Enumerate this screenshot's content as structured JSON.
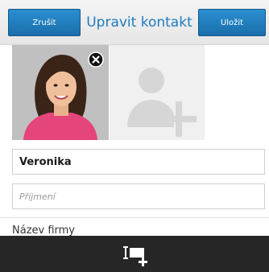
{
  "header": {
    "cancel_label": "Zrušit",
    "title": "Upravit kontakt",
    "save_label": "Uložit"
  },
  "form": {
    "first_name_value": "Veronika",
    "last_name_placeholder": "Příjmení",
    "company_label": "Název firmy"
  },
  "icons": {
    "remove_photo": "close-icon",
    "add_photo": "add-contact-icon",
    "bottom_action": "add-field-icon"
  },
  "colors": {
    "accent": "#1f7bc1",
    "button": "#1a6eab",
    "bottom_bar": "#262626"
  }
}
